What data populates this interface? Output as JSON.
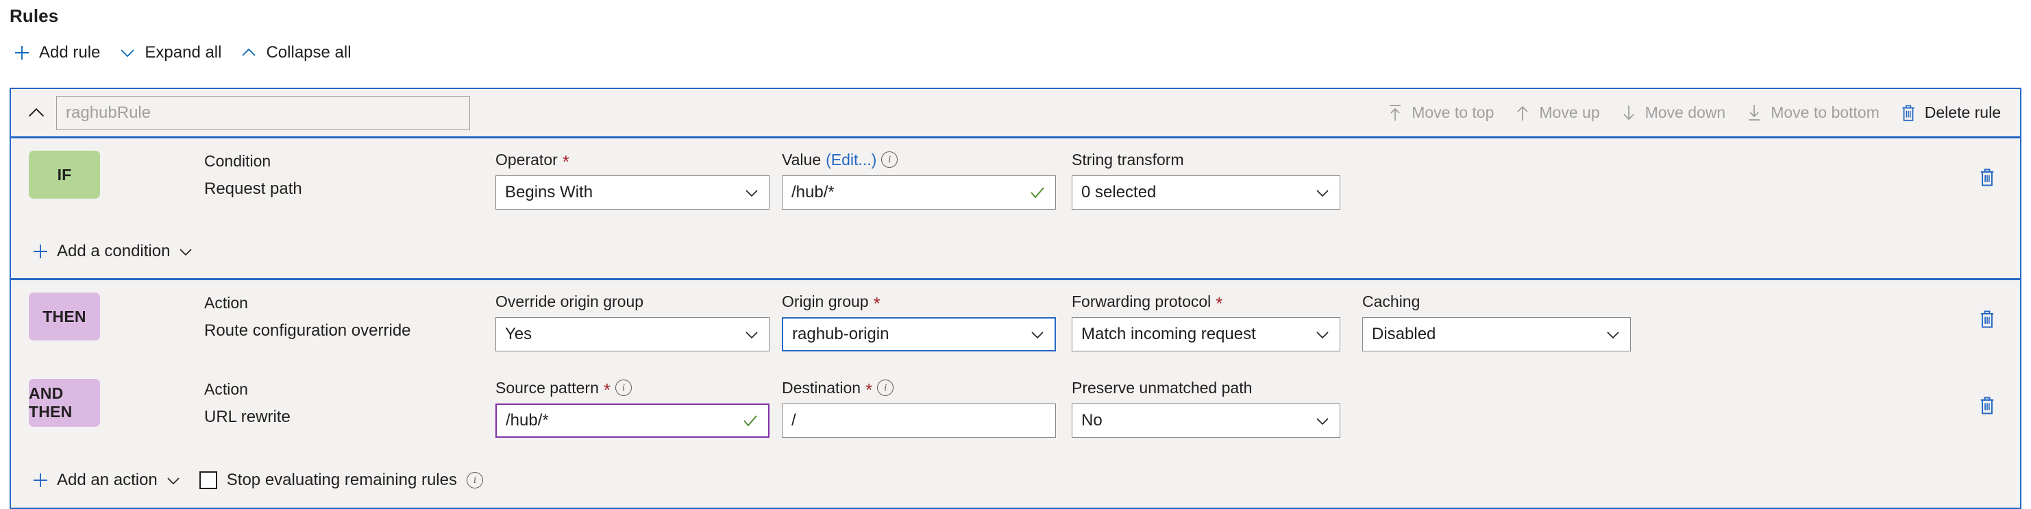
{
  "header": {
    "title": "Rules",
    "commands": [
      {
        "icon": "plus-icon",
        "label": "Add rule"
      },
      {
        "icon": "chevron-down-icon",
        "label": "Expand all"
      },
      {
        "icon": "chevron-up-icon",
        "label": "Collapse all"
      }
    ]
  },
  "rule": {
    "name_placeholder": "raghubRule",
    "collapse_icon": "chevron-up-icon",
    "actions": [
      {
        "icon": "arrow-up-to-line-icon",
        "label": "Move to top",
        "enabled": false
      },
      {
        "icon": "arrow-up-icon",
        "label": "Move up",
        "enabled": false
      },
      {
        "icon": "arrow-down-icon",
        "label": "Move down",
        "enabled": false
      },
      {
        "icon": "arrow-down-to-line-icon",
        "label": "Move to bottom",
        "enabled": false
      },
      {
        "icon": "trash-icon",
        "label": "Delete rule",
        "enabled": true
      }
    ]
  },
  "if_section": {
    "badge": "IF",
    "condition_label": "Condition",
    "condition_value": "Request path",
    "operator_label": "Operator",
    "operator_required": "*",
    "operator_value": "Begins With",
    "value_label": "Value",
    "value_edit_link": "(Edit...)",
    "value_info": "info-icon",
    "value_value": "/hub/*",
    "string_transform_label": "String transform",
    "string_transform_value": "0 selected",
    "add_condition_label": "Add a condition",
    "delete_icon": "trash-icon"
  },
  "then_section": {
    "rows": [
      {
        "badge": "THEN",
        "action_label": "Action",
        "action_value": "Route configuration override",
        "f1_label": "Override origin group",
        "f1_required": "",
        "f1_value": "Yes",
        "f2_label": "Origin group",
        "f2_required": "*",
        "f2_value": "raghub-origin",
        "f3_label": "Forwarding protocol",
        "f3_required": "*",
        "f3_value": "Match incoming request",
        "f4_label": "Caching",
        "f4_required": "",
        "f4_value": "Disabled",
        "delete_icon": "trash-icon"
      },
      {
        "badge": "AND THEN",
        "action_label": "Action",
        "action_value": "URL rewrite",
        "f1_label": "Source pattern",
        "f1_required": "*",
        "f1_value": "/hub/*",
        "f2_label": "Destination",
        "f2_required": "*",
        "f2_value": "/",
        "f3_label": "Preserve unmatched path",
        "f3_required": "",
        "f3_value": "No",
        "delete_icon": "trash-icon"
      }
    ],
    "add_action_label": "Add an action",
    "stop_evaluating_label": "Stop evaluating remaining rules",
    "stop_evaluating_checked": false,
    "stop_info": "info-icon"
  },
  "colors": {
    "accent": "#2567c4",
    "if_badge": "#b3d694",
    "then_badge": "#dcb9e3",
    "required": "#a4262c",
    "valid_check": "#4d8f2f",
    "surface": "#f3f2f1",
    "focus_purple": "#8031a7"
  }
}
